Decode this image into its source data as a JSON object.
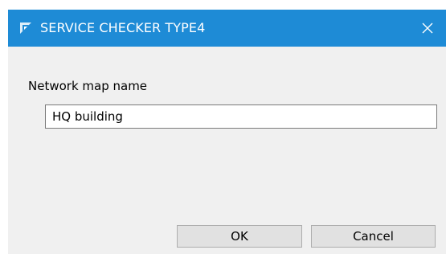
{
  "window": {
    "title": "SERVICE CHECKER TYPE4",
    "app_icon": "app-logo-icon",
    "close_icon": "close-icon",
    "titlebar_color": "#1e8bd6",
    "body_color": "#f0f0f0"
  },
  "form": {
    "label": "Network map name",
    "input_value": "HQ building",
    "input_placeholder": ""
  },
  "buttons": {
    "ok_label": "OK",
    "cancel_label": "Cancel"
  }
}
